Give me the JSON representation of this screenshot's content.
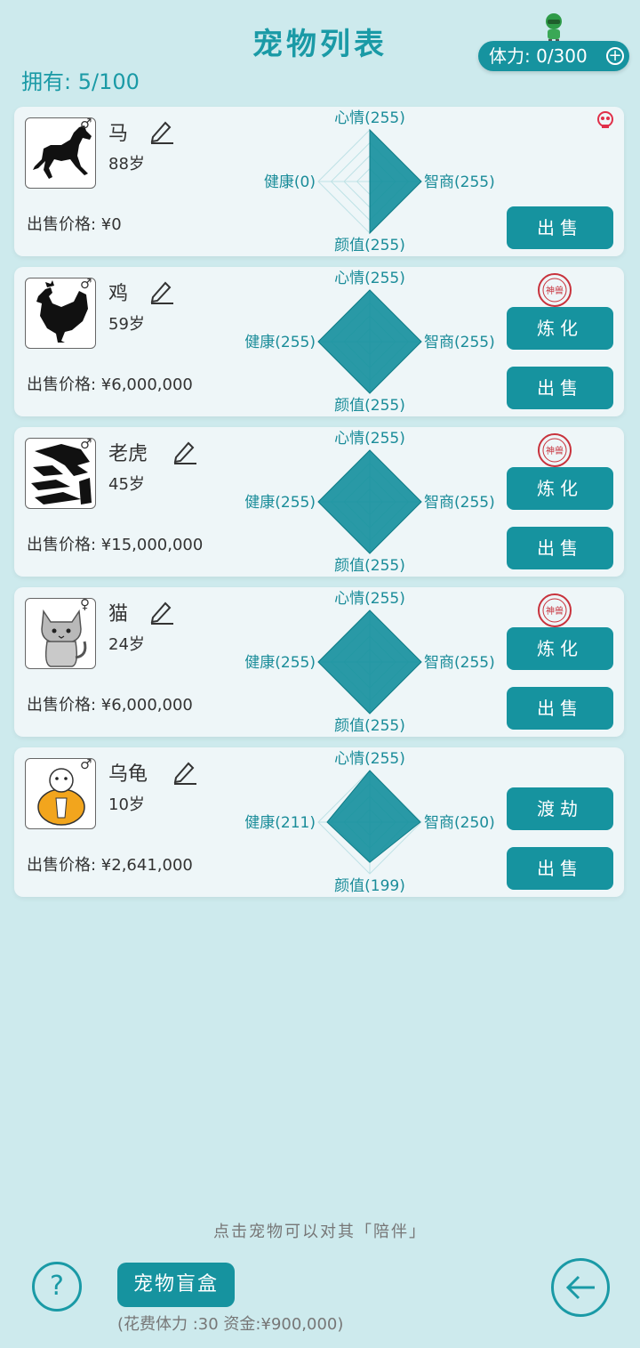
{
  "header": {
    "title": "宠物列表",
    "stamina_label": "体力: 0/300",
    "owned_label": "拥有: 5/100"
  },
  "pets": [
    {
      "name": "马",
      "gender": "♂",
      "age": "88岁",
      "price": "出售价格: ¥0",
      "stats": {
        "mood": 255,
        "iq": 255,
        "looks": 255,
        "health": 0
      },
      "labels": {
        "mood": "心情(255)",
        "iq": "智商(255)",
        "looks": "颜值(255)",
        "health": "健康(0)"
      },
      "buttons": [
        "出售"
      ],
      "badge": "skull"
    },
    {
      "name": "鸡",
      "gender": "♂",
      "age": "59岁",
      "price": "出售价格: ¥6,000,000",
      "stats": {
        "mood": 255,
        "iq": 255,
        "looks": 255,
        "health": 255
      },
      "labels": {
        "mood": "心情(255)",
        "iq": "智商(255)",
        "looks": "颜值(255)",
        "health": "健康(255)"
      },
      "buttons": [
        "炼化",
        "出售"
      ],
      "badge": "seal"
    },
    {
      "name": "老虎",
      "gender": "♂",
      "age": "45岁",
      "price": "出售价格: ¥15,000,000",
      "stats": {
        "mood": 255,
        "iq": 255,
        "looks": 255,
        "health": 255
      },
      "labels": {
        "mood": "心情(255)",
        "iq": "智商(255)",
        "looks": "颜值(255)",
        "health": "健康(255)"
      },
      "buttons": [
        "炼化",
        "出售"
      ],
      "badge": "seal"
    },
    {
      "name": "猫",
      "gender": "♀",
      "age": "24岁",
      "price": "出售价格: ¥6,000,000",
      "stats": {
        "mood": 255,
        "iq": 255,
        "looks": 255,
        "health": 255
      },
      "labels": {
        "mood": "心情(255)",
        "iq": "智商(255)",
        "looks": "颜值(255)",
        "health": "健康(255)"
      },
      "buttons": [
        "炼化",
        "出售"
      ],
      "badge": "seal"
    },
    {
      "name": "乌龟",
      "gender": "♂",
      "age": "10岁",
      "price": "出售价格: ¥2,641,000",
      "stats": {
        "mood": 255,
        "iq": 250,
        "looks": 199,
        "health": 211
      },
      "labels": {
        "mood": "心情(255)",
        "iq": "智商(250)",
        "looks": "颜值(199)",
        "health": "健康(211)"
      },
      "buttons": [
        "渡劫",
        "出售"
      ],
      "badge": ""
    }
  ],
  "seal_text": "神兽",
  "footer": {
    "hint": "点击宠物可以对其「陪伴」",
    "help_label": "?",
    "blind_box_label": "宠物盲盒",
    "cost_label": "(花费体力 :30    资金:¥900,000)"
  },
  "colors": {
    "accent": "#16939f",
    "background": "#cdeaed",
    "card": "#eef6f8",
    "skull": "#e0304a",
    "seal": "#c8323c"
  }
}
